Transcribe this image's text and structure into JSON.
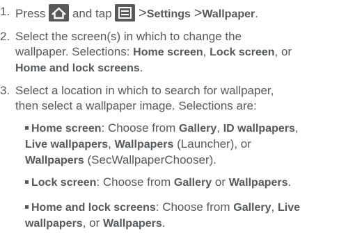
{
  "steps": [
    {
      "num": "1.",
      "press": "Press",
      "and_tap": "and tap",
      "gt1": ">",
      "settings": "Settings",
      "gt2": ">",
      "wallpaper": "Wallpaper",
      "end": ".",
      "home_icon": "home-icon",
      "menu_icon": "menu-icon"
    },
    {
      "num": "2.",
      "l1": "Select the screen(s) in which to change the",
      "l2a": "wallpaper. Selections:",
      "l2b": "Home screen",
      "l2c": ",",
      "l2d": "Lock screen",
      "l2e": ", or",
      "l3a": "Home and lock screens",
      "l3b": "."
    },
    {
      "num": "3.",
      "l1": "Select a location in which to search for wallpaper,",
      "l2": "then select a wallpaper image. Selections are:"
    }
  ],
  "bullets": [
    {
      "title": "Home screen",
      "r1a": ": Choose from",
      "r1b": "Gallery",
      "r1c": ",",
      "r1d": "ID wallpapers",
      "r1e": ",",
      "r2a": "Live wallpapers",
      "r2b": ",",
      "r2c": "Wallpapers",
      "r2d": "(Launcher), or",
      "r3a": "Wallpapers",
      "r3b": "(SecWallpaperChooser)."
    },
    {
      "title": "Lock screen",
      "r1a": ": Choose from",
      "r1b": "Gallery",
      "r1c": "or",
      "r1d": "Wallpapers",
      "r1e": "."
    },
    {
      "title": "Home and lock screens",
      "r1a": ": Choose from",
      "r1b": "Gallery",
      "r1c": ",",
      "r1d": "Live",
      "r2a": "wallpapers",
      "r2b": ", or",
      "r2c": "Wallpapers",
      "r2d": "."
    }
  ]
}
